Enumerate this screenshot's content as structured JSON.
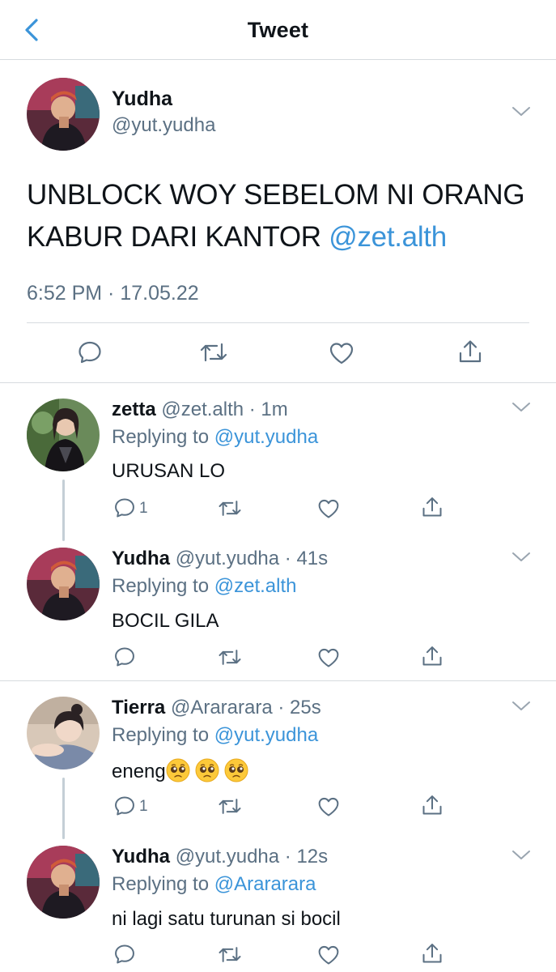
{
  "header": {
    "title": "Tweet"
  },
  "main_tweet": {
    "name": "Yudha",
    "handle": "@yut.yudha",
    "text": "UNBLOCK WOY SEBELOM NI ORANG KABUR DARI KANTOR",
    "mention": "@zet.alth",
    "timestamp": "6:52 PM · 17.05.22"
  },
  "replies": [
    {
      "name": "zetta",
      "meta": "@zet.alth · 1m",
      "replying_prefix": "Replying to",
      "replying_to": "@yut.yudha",
      "text": "URUSAN LO",
      "reply_count": "1"
    },
    {
      "name": "Yudha",
      "meta": "@yut.yudha · 41s",
      "replying_prefix": "Replying to",
      "replying_to": "@zet.alth",
      "text": "BOCIL GILA",
      "reply_count": ""
    },
    {
      "name": "Tierra",
      "meta": "@Arararara · 25s",
      "replying_prefix": "Replying to",
      "replying_to": "@yut.yudha",
      "text": "eneng",
      "emojis": [
        "pleading-face",
        "pleading-face",
        "pleading-face"
      ],
      "reply_count": "1"
    },
    {
      "name": "Yudha",
      "meta": "@yut.yudha · 12s",
      "replying_prefix": "Replying to",
      "replying_to": "@Arararara",
      "text": "ni lagi satu turunan si bocil",
      "reply_count": ""
    }
  ],
  "icons": {
    "back": "chevron-left-icon",
    "more": "chevron-down-icon",
    "reply": "comment-icon",
    "retweet": "retweet-icon",
    "like": "heart-icon",
    "share": "share-icon"
  },
  "colors": {
    "accent": "#3b94d9",
    "muted": "#5b7083",
    "divider": "#d7dbdf"
  }
}
